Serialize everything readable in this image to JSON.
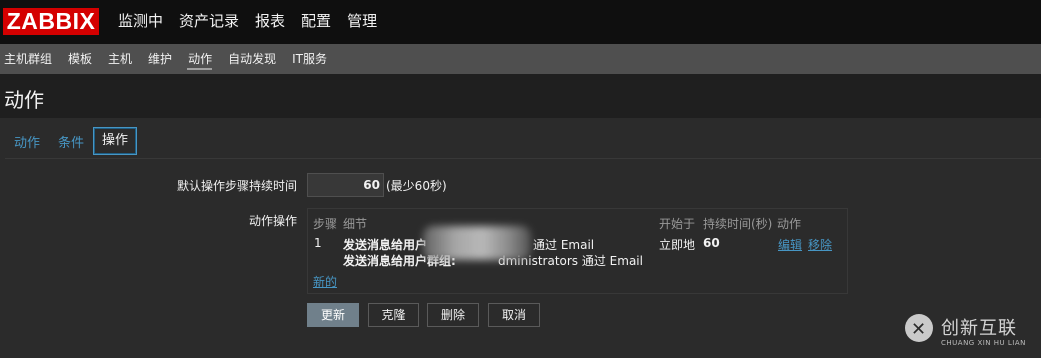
{
  "logo": "ZABBIX",
  "main_menu": [
    "监测中",
    "资产记录",
    "报表",
    "配置",
    "管理"
  ],
  "sub_menu": {
    "items": [
      "主机群组",
      "模板",
      "主机",
      "维护",
      "动作",
      "自动发现",
      "IT服务"
    ],
    "active": "动作"
  },
  "page_title": "动作",
  "tabs": {
    "items": [
      "动作",
      "条件",
      "操作"
    ],
    "active": "操作"
  },
  "form": {
    "default_duration_label": "默认操作步骤持续时间",
    "default_duration_value": "60",
    "default_duration_hint": "(最少60秒)",
    "operations_label": "动作操作",
    "operations_table": {
      "headers": {
        "step": "步骤",
        "details": "细节",
        "start_in": "开始于",
        "duration": "持续时间(秒)",
        "action": "动作"
      },
      "row": {
        "step": "1",
        "detail_line1_prefix": "发送消息给用户",
        "detail_line1_suffix": "通过 Email",
        "detail_line2_prefix": "发送消息给用户群组:",
        "detail_line2_suffix": "dministrators 通过 Email",
        "start_in": "立即地",
        "duration": "60",
        "edit_link": "编辑",
        "remove_link": "移除"
      },
      "new_link": "新的"
    }
  },
  "buttons": {
    "update": "更新",
    "clone": "克隆",
    "delete": "删除",
    "cancel": "取消"
  },
  "watermark": {
    "icon_glyph": "✕",
    "title": "创新互联",
    "subtitle": "CHUANG XIN HU LIAN"
  }
}
